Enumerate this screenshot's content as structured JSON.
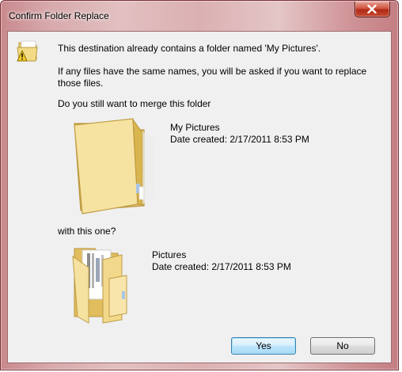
{
  "window": {
    "title": "Confirm Folder Replace"
  },
  "message": {
    "line1": "This destination already contains a folder named 'My Pictures'.",
    "line2a": "If any files have the same names, you will be asked if you want to replace",
    "line2b": "those files.",
    "question": "Do you still want to merge this folder"
  },
  "source_folder": {
    "name": "My Pictures",
    "date": "Date created: 2/17/2011 8:53 PM"
  },
  "connector": "with this one?",
  "target_folder": {
    "name": "Pictures",
    "date": "Date created: 2/17/2011 8:53 PM"
  },
  "buttons": {
    "yes": "Yes",
    "no": "No"
  }
}
